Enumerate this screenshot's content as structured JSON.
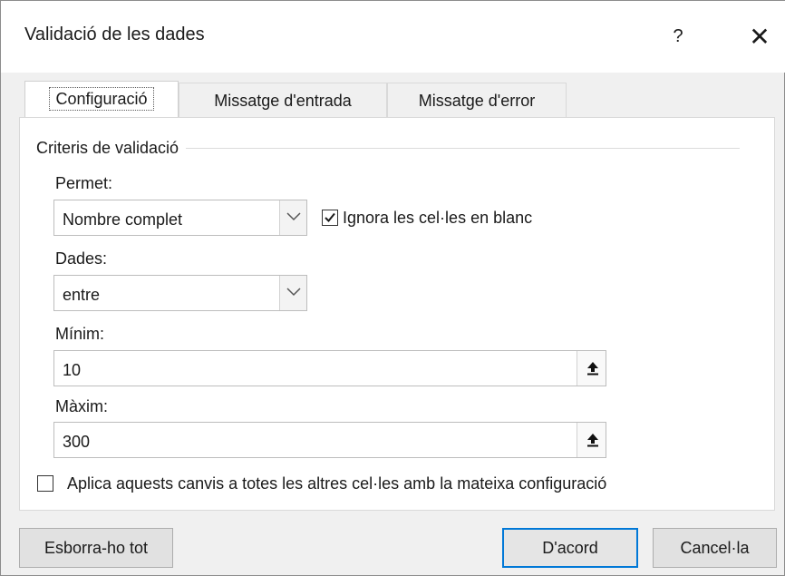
{
  "window": {
    "title": "Validació de les dades",
    "help": "?",
    "close": "✕"
  },
  "tabs": [
    {
      "label": "Configuració",
      "active": true
    },
    {
      "label": "Missatge d'entrada",
      "active": false
    },
    {
      "label": "Missatge d'error",
      "active": false
    }
  ],
  "criteria": {
    "group_label": "Criteris de validació",
    "permet_label": "Permet:",
    "permet_value": "Nombre complet",
    "ignora_label": "Ignora les cel·les en blanc",
    "ignora_checked": true,
    "dades_label": "Dades:",
    "dades_value": "entre",
    "minim_label": "Mínim:",
    "minim_value": "10",
    "maxim_label": "Màxim:",
    "maxim_value": "300",
    "aplica_label": "Aplica aquests canvis a totes les altres cel·les amb la mateixa configuració",
    "aplica_checked": false
  },
  "footer": {
    "clear_all": "Esborra-ho tot",
    "ok": "D'acord",
    "cancel": "Cancel·la"
  },
  "colors": {
    "accent": "#0078d7",
    "background": "#f0f0f0",
    "panel": "#ffffff"
  },
  "icons": {
    "checkbox_checked": "checkmark-icon",
    "dropdown": "chevron-down-icon",
    "range_selector": "collapse-dialog-icon",
    "close": "close-icon",
    "help": "help-icon"
  }
}
